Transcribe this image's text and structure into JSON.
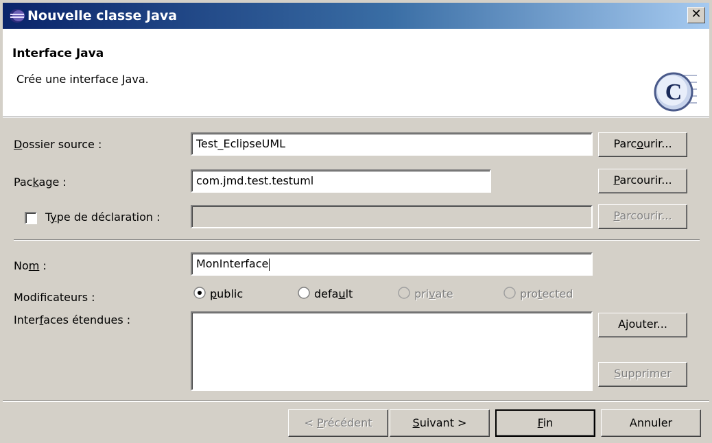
{
  "window": {
    "title": "Nouvelle classe Java",
    "close_glyph": "✕"
  },
  "banner": {
    "title": "Interface Java",
    "description": "Crée une interface Java.",
    "icon_letter": "C"
  },
  "fields": {
    "source_folder": {
      "label_pre": "",
      "label_ul": "D",
      "label_post": "ossier source :",
      "value": "Test_EclipseUML",
      "button_pre": "Parc",
      "button_ul": "o",
      "button_post": "urir..."
    },
    "package": {
      "label_pre": "Pac",
      "label_ul": "k",
      "label_post": "age :",
      "value": "com.jmd.test.testuml",
      "button_pre": "",
      "button_ul": "P",
      "button_post": "arcourir..."
    },
    "enclosing_type": {
      "label_pre": "T",
      "label_ul": "y",
      "label_post": "pe de déclaration :",
      "value": "",
      "checked": false,
      "button_pre": "",
      "button_ul": "P",
      "button_post": "arcourir..."
    },
    "name": {
      "label_pre": "No",
      "label_ul": "m",
      "label_post": " :",
      "value": "MonInterface"
    },
    "modifiers": {
      "label": "Modificateurs :",
      "options": [
        {
          "pre": "",
          "ul": "p",
          "post": "ublic",
          "selected": true,
          "enabled": true
        },
        {
          "pre": "defa",
          "ul": "u",
          "post": "lt",
          "selected": false,
          "enabled": true
        },
        {
          "pre": "pri",
          "ul": "v",
          "post": "ate",
          "selected": false,
          "enabled": false
        },
        {
          "pre": "pro",
          "ul": "t",
          "post": "ected",
          "selected": false,
          "enabled": false
        }
      ]
    },
    "extended_interfaces": {
      "label_pre": "Inter",
      "label_ul": "f",
      "label_post": "aces étendues :",
      "add_pre": "A",
      "add_ul": "j",
      "add_post": "outer...",
      "remove_pre": "",
      "remove_ul": "S",
      "remove_post": "upprimer"
    }
  },
  "footer": {
    "back": {
      "pre": "< ",
      "ul": "P",
      "post": "récédent"
    },
    "next": {
      "pre": "",
      "ul": "S",
      "post": "uivant >"
    },
    "finish": {
      "pre": "",
      "ul": "F",
      "post": "in"
    },
    "cancel": "Annuler"
  }
}
